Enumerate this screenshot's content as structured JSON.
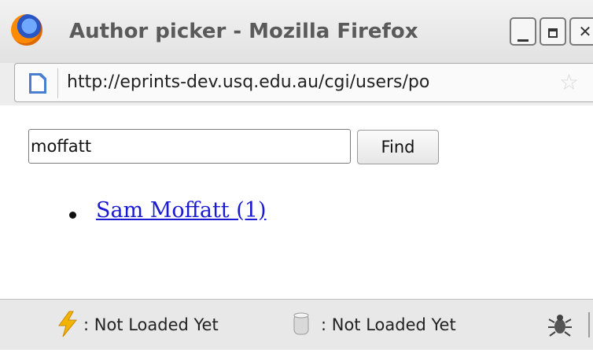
{
  "window": {
    "title": "Author picker - Mozilla Firefox",
    "icon": "firefox-logo",
    "buttons": [
      "minimize",
      "maximize",
      "close"
    ]
  },
  "address_bar": {
    "url": "http://eprints-dev.usq.edu.au/cgi/users/po",
    "page_icon": "page-icon",
    "bookmark_icon": "star-icon"
  },
  "search": {
    "value": "moffatt",
    "button_label": "Find"
  },
  "results": [
    {
      "label": "Sam Moffatt (1)"
    }
  ],
  "status_bar": {
    "items": [
      {
        "icon": "lightning-bolt-icon",
        "text": ": Not Loaded Yet"
      },
      {
        "icon": "database-icon",
        "text": ": Not Loaded Yet"
      }
    ],
    "bug_icon": "firebug-icon"
  },
  "colors": {
    "link": "#1a1ad0",
    "title_text": "#5a5a5a",
    "bolt": "#f2b400"
  }
}
